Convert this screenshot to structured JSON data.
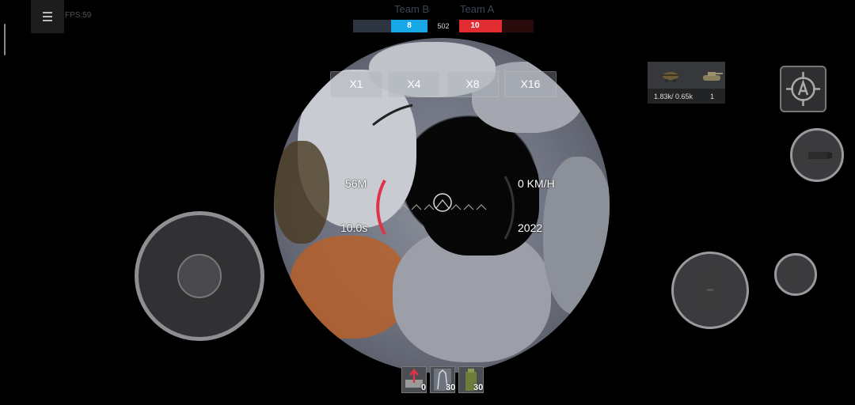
{
  "hud": {
    "fps": "FPS:59"
  },
  "score": {
    "team_b": {
      "name": "Team B",
      "score": "8",
      "color": "#17a6e6"
    },
    "team_a": {
      "name": "Team A",
      "score": "10",
      "color": "#e12d32"
    },
    "timer": "502"
  },
  "zoom_options": [
    "X1",
    "X4",
    "X8",
    "X16"
  ],
  "scope": {
    "range": "56M",
    "reload": "10.0s",
    "speed": "0 KM/H",
    "year": "2022"
  },
  "squad": {
    "kd": "1.83k/ 0.65k",
    "count": "1"
  },
  "ammo": [
    {
      "icon": "he-shell-icon",
      "count": "0"
    },
    {
      "icon": "ap-shell-icon",
      "count": "30"
    },
    {
      "icon": "heat-shell-icon",
      "count": "30"
    }
  ],
  "colors": {
    "accent_red": "#e0334a"
  }
}
